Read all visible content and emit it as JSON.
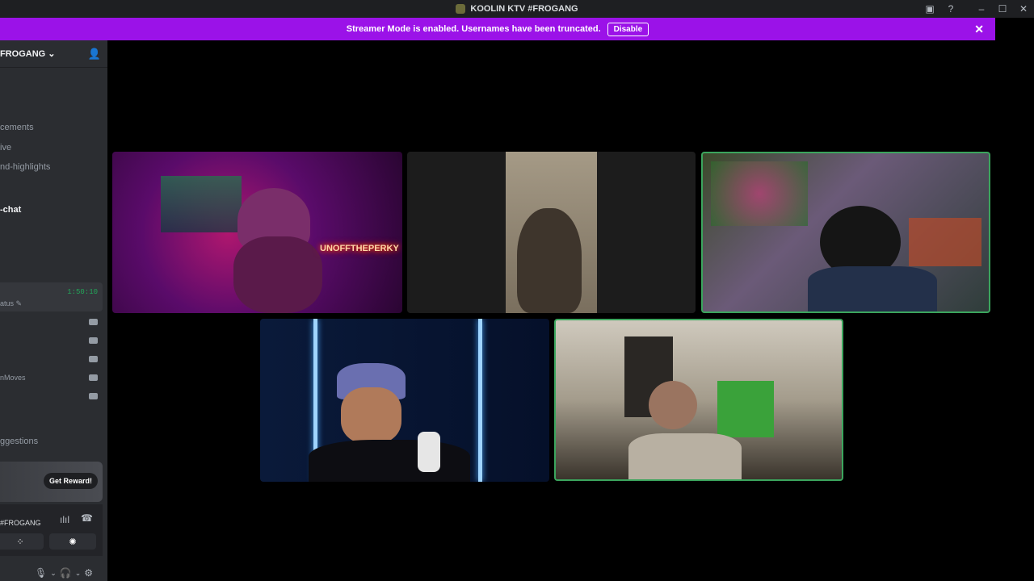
{
  "window": {
    "title": "KOOLIN KTV #FROGANG",
    "controls": [
      "cast-icon",
      "help-icon",
      "minimize-icon",
      "maximize-icon",
      "close-icon"
    ]
  },
  "banner": {
    "message": "Streamer Mode is enabled. Usernames have been truncated.",
    "disable_label": "Disable"
  },
  "sidebar": {
    "server_name": "FROGANG",
    "channels": [
      {
        "label": "cements",
        "active": false
      },
      {
        "label": "ive",
        "active": false
      },
      {
        "label": "nd-highlights",
        "active": false
      },
      {
        "label": "-chat",
        "active": true
      },
      {
        "label": "ggestions",
        "active": false
      }
    ],
    "voice_timer": "1:50:10",
    "voice_status": "atus",
    "voice_users": [
      "",
      "",
      "",
      "nMoves",
      ""
    ],
    "reward_button": "Get Reward!",
    "connected_server": "#FROGANG"
  },
  "stage": {
    "neon_sign": "UNOFFTHEPERKY"
  },
  "colors": {
    "banner": "#9b12e8",
    "speaking_border": "#3ba55d",
    "sidebar_bg": "#2b2d31"
  }
}
